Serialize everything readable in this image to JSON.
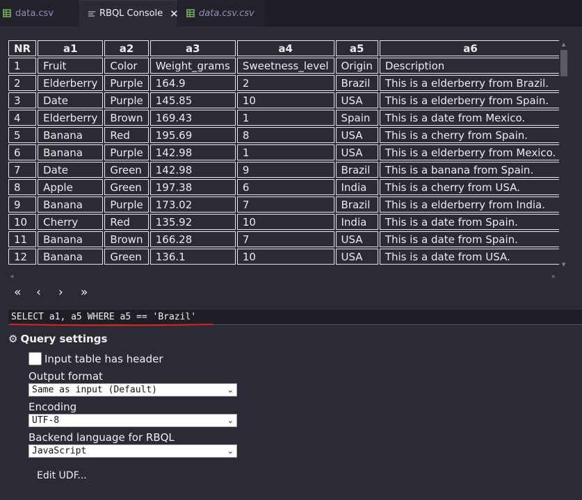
{
  "tabs": [
    {
      "label": "data.csv",
      "icon": "spreadsheet-icon"
    },
    {
      "label": "RBQL Console",
      "icon": "list-icon",
      "close": "✕"
    },
    {
      "label": "data.csv.csv",
      "icon": "spreadsheet-icon"
    }
  ],
  "table": {
    "headers": [
      "NR",
      "a1",
      "a2",
      "a3",
      "a4",
      "a5",
      "a6"
    ],
    "rows": [
      [
        "1",
        "Fruit",
        "Color",
        "Weight_grams",
        "Sweetness_level",
        "Origin",
        "Description"
      ],
      [
        "2",
        "Elderberry",
        "Purple",
        "164.9",
        "2",
        "Brazil",
        "This is a elderberry from Brazil."
      ],
      [
        "3",
        "Date",
        "Purple",
        "145.85",
        "10",
        "USA",
        "This is a elderberry from Spain."
      ],
      [
        "4",
        "Elderberry",
        "Brown",
        "169.43",
        "1",
        "Spain",
        "This is a date from Mexico."
      ],
      [
        "5",
        "Banana",
        "Red",
        "195.69",
        "8",
        "USA",
        "This is a cherry from Spain."
      ],
      [
        "6",
        "Banana",
        "Purple",
        "142.98",
        "1",
        "USA",
        "This is a elderberry from Mexico."
      ],
      [
        "7",
        "Date",
        "Green",
        "142.98",
        "9",
        "Brazil",
        "This is a banana from Spain."
      ],
      [
        "8",
        "Apple",
        "Green",
        "197.38",
        "6",
        "India",
        "This is a cherry from USA."
      ],
      [
        "9",
        "Banana",
        "Purple",
        "173.02",
        "7",
        "Brazil",
        "This is a elderberry from India."
      ],
      [
        "10",
        "Cherry",
        "Red",
        "135.92",
        "10",
        "India",
        "This is a date from Spain."
      ],
      [
        "11",
        "Banana",
        "Brown",
        "166.28",
        "7",
        "USA",
        "This is a date from Spain."
      ],
      [
        "12",
        "Banana",
        "Green",
        "136.1",
        "10",
        "USA",
        "This is a date from USA."
      ]
    ]
  },
  "pager": [
    "«",
    "‹",
    "›",
    "»"
  ],
  "query": {
    "text": "SELECT a1, a5 WHERE a5 == 'Brazil'"
  },
  "settings": {
    "title": "Query settings",
    "header_checkbox_label": "Input table has header",
    "output_format_label": "Output format",
    "output_format_value": "Same as input (Default)",
    "encoding_label": "Encoding",
    "encoding_value": "UTF-8",
    "backend_label": "Backend language for RBQL",
    "backend_value": "JavaScript",
    "edit_udf": "Edit UDF..."
  },
  "colors": {
    "background": "#2b2b36",
    "tabbar": "#1f1e27",
    "squiggle": "#e02020",
    "spreadsheet_icon": "#7fc45a"
  }
}
